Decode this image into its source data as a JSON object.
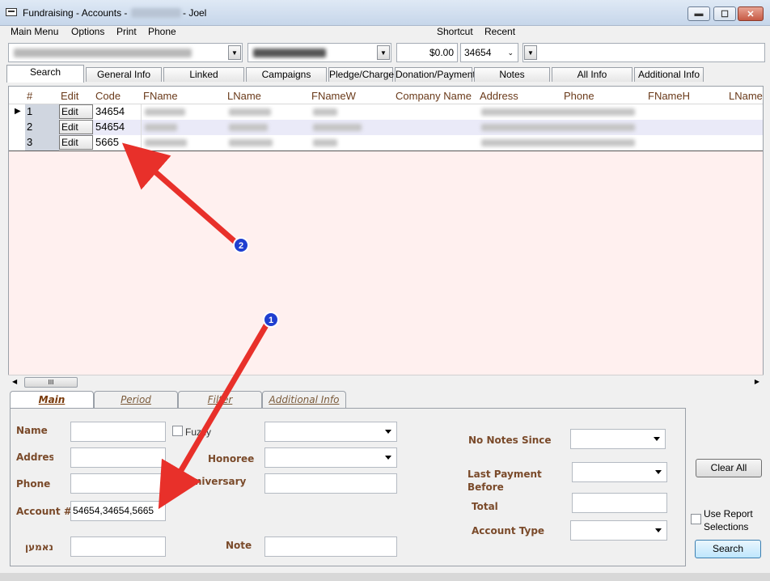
{
  "window": {
    "title_prefix": "Fundraising - Accounts -",
    "title_user": "- Joel",
    "minimize_glyph": "▬",
    "maximize_glyph": "☐",
    "close_glyph": "✕"
  },
  "menu": {
    "items": [
      "Main Menu",
      "Options",
      "Print",
      "Phone"
    ],
    "right_items": [
      "Shortcut",
      "Recent"
    ]
  },
  "toolbar": {
    "amount": "$0.00",
    "account_code": "34654"
  },
  "tabs": [
    "Search",
    "General Info",
    "Linked",
    "Campaigns",
    "Pledge/Charge",
    "Donation/Payment",
    "Notes",
    "All Info",
    "Additional Info"
  ],
  "grid": {
    "columns": [
      "#",
      "Edit",
      "Code",
      "FName",
      "LName",
      "FNameW",
      "Company Name",
      "Address",
      "Phone",
      "FNameH",
      "LNameH"
    ],
    "edit_label": "Edit",
    "rows": [
      {
        "num": "1",
        "code": "34654"
      },
      {
        "num": "2",
        "code": "54654"
      },
      {
        "num": "3",
        "code": "5665"
      }
    ],
    "scroll_thumb": "III"
  },
  "filter_tabs": [
    "Main",
    "Period",
    "Filter",
    "Additional Info"
  ],
  "filter": {
    "name_label": "Name",
    "fuzzy_label": "Fuzzy",
    "address_label": "Address",
    "honoree_label": "Honoree",
    "phone_label": "Phone",
    "anniversary_label": "Anniversary",
    "account_label": "Account #",
    "account_value": "54654,34654,5665",
    "hebrew_label": "נאמען",
    "note_label": "Note",
    "no_notes_label": "No Notes Since",
    "last_payment_label": "Last Payment",
    "last_payment_label2": "Before",
    "total_label": "Total",
    "account_type_label": "Account Type"
  },
  "buttons": {
    "clear_all": "Clear All",
    "use_report": "Use Report",
    "use_report2": "Selections",
    "search": "Search"
  },
  "annotations": [
    {
      "label": "1",
      "color": "#1f3fd0"
    },
    {
      "label": "2",
      "color": "#1f3fd0"
    }
  ],
  "colors": {
    "arrow": "#e8302a",
    "grid_background": "#fff0ef",
    "label_brown": "#7a4a2a"
  }
}
